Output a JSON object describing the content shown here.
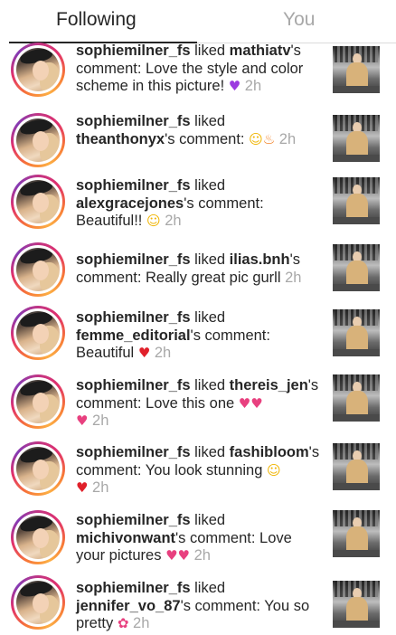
{
  "tabs": {
    "following": "Following",
    "you": "You"
  },
  "activity": [
    {
      "actor": "sophiemilner_fs",
      "pre": " liked ",
      "target": "mathiatv",
      "post": "'s comment: Love the style and color scheme in this picture!",
      "emojis": [
        {
          "char": "♥",
          "icon": "purple-heart-icon",
          "color": "#9b3ae0"
        }
      ],
      "time": "2h"
    },
    {
      "actor": "sophiemilner_fs",
      "pre": " liked ",
      "target": "theanthonyx",
      "post": "'s comment:",
      "emojis": [
        {
          "char": "☺",
          "icon": "heart-eyes-face-icon",
          "color": "#f0b400"
        },
        {
          "char": "♨",
          "icon": "fire-icon",
          "color": "#f27a1a"
        }
      ],
      "time": "2h"
    },
    {
      "actor": "sophiemilner_fs",
      "pre": " liked ",
      "target": "alexgracejones",
      "post": "'s comment: Beautiful!!",
      "emojis": [
        {
          "char": "☺",
          "icon": "heart-eyes-face-icon",
          "color": "#f0b400"
        }
      ],
      "time": "2h"
    },
    {
      "actor": "sophiemilner_fs",
      "pre": " liked ",
      "target": "ilias.bnh",
      "post": "'s comment: Really great pic gurll",
      "emojis": [],
      "time": "2h"
    },
    {
      "actor": "sophiemilner_fs",
      "pre": " liked ",
      "target": "femme_editorial",
      "post": "'s comment: Beautiful",
      "emojis": [
        {
          "char": "♥",
          "icon": "red-heart-icon",
          "color": "#e0202a"
        }
      ],
      "time": "2h"
    },
    {
      "actor": "sophiemilner_fs",
      "pre": " liked ",
      "target": "thereis_jen",
      "post": "'s comment: Love this one",
      "emojis": [
        {
          "char": "♥",
          "icon": "two-hearts-icon",
          "color": "#e8407f"
        },
        {
          "char": "♥",
          "icon": "two-hearts-icon",
          "color": "#e8407f"
        },
        {
          "char": "♥",
          "icon": "two-hearts-icon",
          "color": "#e8407f"
        }
      ],
      "time": "2h"
    },
    {
      "actor": "sophiemilner_fs",
      "pre": " liked ",
      "target": "fashibloom",
      "post": "'s comment: You look stunning",
      "emojis": [
        {
          "char": "☺",
          "icon": "heart-eyes-face-icon",
          "color": "#f0b400"
        },
        {
          "char": "♥",
          "icon": "red-heart-icon",
          "color": "#e0202a"
        }
      ],
      "time": "2h"
    },
    {
      "actor": "sophiemilner_fs",
      "pre": " liked ",
      "target": "michivonwant",
      "post": "'s comment: Love your pictures",
      "emojis": [
        {
          "char": "♥",
          "icon": "two-hearts-icon",
          "color": "#e8407f"
        },
        {
          "char": "♥",
          "icon": "two-hearts-icon",
          "color": "#e8407f"
        }
      ],
      "time": "2h"
    },
    {
      "actor": "sophiemilner_fs",
      "pre": " liked ",
      "target": "jennifer_vo_87",
      "post": "'s comment: You so pretty",
      "emojis": [
        {
          "char": "✿",
          "icon": "bouquet-icon",
          "color": "#e8407f"
        }
      ],
      "time": "2h"
    }
  ]
}
